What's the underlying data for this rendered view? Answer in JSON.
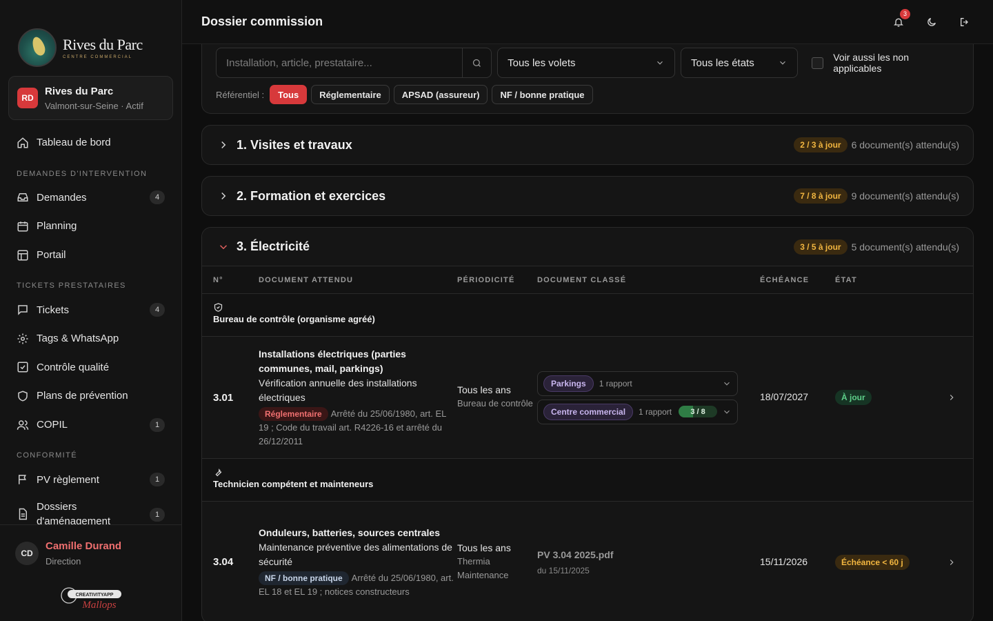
{
  "sidebar": {
    "logo": {
      "name": "Rives du Parc",
      "sub": "CENTRE COMMERCIAL"
    },
    "site": {
      "badge": "RD",
      "name": "Rives du Parc",
      "location": "Valmont-sur-Seine · Actif"
    },
    "items_top": [
      {
        "label": "Tableau de bord",
        "icon": "home-icon"
      }
    ],
    "sections": [
      {
        "title": "DEMANDES D'INTERVENTION",
        "items": [
          {
            "label": "Demandes",
            "icon": "inbox-icon",
            "count": "4"
          },
          {
            "label": "Planning",
            "icon": "calendar-icon",
            "count": ""
          },
          {
            "label": "Portail",
            "icon": "layout-icon",
            "count": ""
          }
        ]
      },
      {
        "title": "TICKETS PRESTATAIRES",
        "items": [
          {
            "label": "Tickets",
            "icon": "message-icon",
            "count": "4"
          },
          {
            "label": "Tags & WhatsApp",
            "icon": "gear-icon",
            "count": ""
          },
          {
            "label": "Contrôle qualité",
            "icon": "check-square-icon",
            "count": ""
          },
          {
            "label": "Plans de prévention",
            "icon": "shield-icon",
            "count": ""
          },
          {
            "label": "COPIL",
            "icon": "users-icon",
            "count": "1"
          }
        ]
      },
      {
        "title": "CONFORMITÉ",
        "items": [
          {
            "label": "PV règlement",
            "icon": "flag-icon",
            "count": "1"
          },
          {
            "label": "Dossiers d'aménagement",
            "icon": "file-icon",
            "count": "1"
          }
        ]
      }
    ],
    "user": {
      "initials": "CD",
      "name": "Camille Durand",
      "role": "Direction"
    },
    "brand": {
      "text1": "CREATIVITYAPP",
      "text2": "Mallops"
    }
  },
  "header": {
    "title": "Dossier commission",
    "notifications": "3"
  },
  "filters": {
    "search_placeholder": "Installation, article, prestataire...",
    "volets": "Tous les volets",
    "etats": "Tous les états",
    "non_applicables": "Voir aussi les non applicables",
    "ref_label": "Référentiel :",
    "refs": [
      "Tous",
      "Réglementaire",
      "APSAD (assureur)",
      "NF / bonne pratique"
    ]
  },
  "sections": [
    {
      "title": "1. Visites et travaux",
      "badge": "2 / 3 à jour",
      "docs": "6 document(s) attendu(s)"
    },
    {
      "title": "2. Formation et exercices",
      "badge": "7 / 8 à jour",
      "docs": "9 document(s) attendu(s)"
    },
    {
      "title": "3. Électricité",
      "badge": "3 / 5 à jour",
      "docs": "5 document(s) attendu(s)"
    }
  ],
  "table": {
    "headers": [
      "N°",
      "DOCUMENT ATTENDU",
      "PÉRIODICITÉ",
      "DOCUMENT CLASSÉ",
      "ÉCHÉANCE",
      "ÉTAT"
    ],
    "groups": [
      {
        "name": "Bureau de contrôle (organisme agréé)",
        "icon": "shield-check-icon"
      },
      {
        "name": "Technicien compétent et mainteneurs",
        "icon": "wrench-icon"
      }
    ],
    "rows": [
      {
        "num": "3.01",
        "title": "Installations électriques (parties communes, mail, parkings)",
        "desc": "Vérification annuelle des installations électriques",
        "tag": "Réglementaire",
        "ref": "Arrêté du 25/06/1980, art. EL 19 ; Code du travail art. R4226-16 et arrêté du 26/12/2011",
        "period": "Tous les ans",
        "period_sub": "Bureau de contrôle",
        "docs": [
          {
            "zone": "Parkings",
            "count": "1 rapport",
            "progress": ""
          },
          {
            "zone": "Centre commercial",
            "count": "1 rapport",
            "progress": "3 / 8",
            "progress_value": 0.375
          }
        ],
        "due": "18/07/2027",
        "state": "À jour"
      },
      {
        "num": "3.04",
        "title": "Onduleurs, batteries, sources centrales",
        "desc": "Maintenance préventive des alimentations de sécurité",
        "tag": "NF / bonne pratique",
        "ref": "Arrêté du 25/06/1980, art. EL 18 et EL 19 ; notices constructeurs",
        "period": "Tous les ans",
        "period_sub": "Thermia Maintenance",
        "file": "PV 3.04 2025.pdf",
        "file_date": "du 15/11/2025",
        "due": "15/11/2026",
        "state": "Échéance < 60 j"
      }
    ]
  }
}
